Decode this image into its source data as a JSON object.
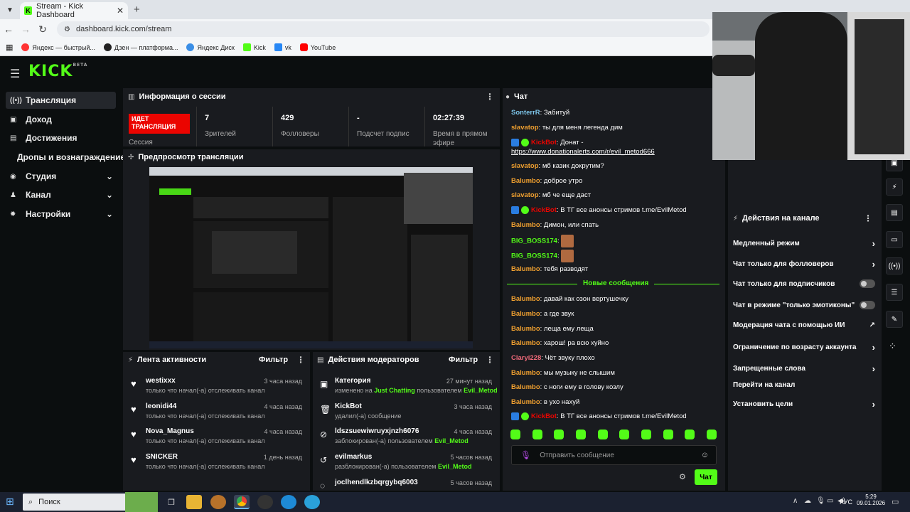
{
  "browser": {
    "tab_title": "Stream - Kick Dashboard",
    "url": "dashboard.kick.com/stream",
    "bookmarks": [
      "Яндекс — быстрый...",
      "Дзен — платформа...",
      "Яндекс Диск",
      "Kick",
      "vk",
      "YouTube"
    ]
  },
  "logo": {
    "text": "KICK",
    "badge": "BETA"
  },
  "sidebar": {
    "items": [
      {
        "label": "Трансляция"
      },
      {
        "label": "Доход"
      },
      {
        "label": "Достижения"
      },
      {
        "label": "Дропы и вознаграждение"
      },
      {
        "label": "Студия"
      },
      {
        "label": "Канал"
      },
      {
        "label": "Настройки"
      }
    ]
  },
  "session": {
    "title": "Информация о сессии",
    "badge_line1": "ИДЕТ",
    "badge_line2": "ТРАНСЛЯЦИЯ",
    "badge_sub": "Сессия",
    "stats": [
      {
        "value": "7",
        "label": "Зрителей"
      },
      {
        "value": "429",
        "label": "Фолловеры"
      },
      {
        "value": "-",
        "label": "Подсчет подпис"
      },
      {
        "value": "02:27:39",
        "label": "Время в прямом эфире"
      }
    ]
  },
  "preview": {
    "title": "Предпросмотр трансляции"
  },
  "activity": {
    "title": "Лента активности",
    "filter": "Фильтр",
    "items": [
      {
        "name": "westixxx",
        "text": "только что начал(-а) отслеживать канал",
        "time": "3 часа назад"
      },
      {
        "name": "leonidi44",
        "text": "только что начал(-а) отслеживать канал",
        "time": "4 часа назад"
      },
      {
        "name": "Nova_Magnus",
        "text": "только что начал(-а) отслеживать канал",
        "time": "4 часа назад"
      },
      {
        "name": "SNICKER",
        "text": "только что начал(-а) отслеживать канал",
        "time": "1 день назад"
      }
    ]
  },
  "moderators": {
    "title": "Действия модераторов",
    "filter": "Фильтр",
    "items": [
      {
        "name": "Категория",
        "pre": "изменено на",
        "hl1": "Just Chatting",
        "mid": "пользователем",
        "hl2": "Evil_Metod",
        "time": "27 минут назад"
      },
      {
        "name": "KickBot",
        "pre": "удалил(-а) сообщение",
        "hl1": "",
        "mid": "",
        "hl2": "",
        "time": "3 часа назад"
      },
      {
        "name": "ldszsuewiwruyxjnzh6076",
        "pre": "заблокирован(-а) пользователем",
        "hl1": "Evil_Metod",
        "mid": "",
        "hl2": "",
        "time": "4 часа назад"
      },
      {
        "name": "evilmarkus",
        "pre": "разблокирован(-а) пользователем",
        "hl1": "Evil_Metod",
        "mid": "",
        "hl2": "",
        "time": "5 часов назад"
      },
      {
        "name": "joclhendlkzbqrgybq6003",
        "pre": "",
        "hl1": "",
        "mid": "",
        "hl2": "",
        "time": "5 часов назад"
      }
    ]
  },
  "chat": {
    "title": "Чат",
    "new_messages": "Новые сообщения",
    "input_placeholder": "Отправить сообщение",
    "send_label": "Чат",
    "messages": [
      {
        "user": "SonterrR",
        "color": "#7cc4e8",
        "text": "Забитуй"
      },
      {
        "user": "slavatop",
        "color": "#f0a030",
        "text": "ты для меня легенда дим"
      },
      {
        "user": "KickBot",
        "color": "#eb0400",
        "text": "Донат -",
        "link": "https://www.donationalerts.com/r/evil_metod666",
        "bot": true
      },
      {
        "user": "slavatop",
        "color": "#f0a030",
        "text": "мб казик докрутим?"
      },
      {
        "user": "Balumbo",
        "color": "#f0a030",
        "text": "доброе утро"
      },
      {
        "user": "slavatop",
        "color": "#f0a030",
        "text": "мб че еще даст"
      },
      {
        "user": "KickBot",
        "color": "#eb0400",
        "text": "В ТГ все анонсы стримов t.me/EvilMetod",
        "bot": true
      },
      {
        "user": "Balumbo",
        "color": "#f0a030",
        "text": "Димон, или спать"
      },
      {
        "user": "BIG_BOSS174",
        "color": "#53fc18",
        "text": "",
        "emote": true
      },
      {
        "user": "BIG_BOSS174",
        "color": "#53fc18",
        "text": "",
        "emote": true
      },
      {
        "user": "Balumbo",
        "color": "#f0a030",
        "text": "тебя разводят"
      },
      {
        "user": "Balumbo",
        "color": "#f0a030",
        "text": "давай как озон вертушечку"
      },
      {
        "user": "Balumbo",
        "color": "#f0a030",
        "text": "а где звук"
      },
      {
        "user": "Balumbo",
        "color": "#f0a030",
        "text": "леща ему леща"
      },
      {
        "user": "Balumbo",
        "color": "#f0a030",
        "text": "харош! ра всю хуйно"
      },
      {
        "user": "Claryi228",
        "color": "#f06a7a",
        "text": "Чёт звуку плохо"
      },
      {
        "user": "Balumbo",
        "color": "#f0a030",
        "text": "мы музыку не слышим"
      },
      {
        "user": "Balumbo",
        "color": "#f0a030",
        "text": "с ноги ему в голову козлу"
      },
      {
        "user": "Balumbo",
        "color": "#f0a030",
        "text": "в ухо нахуй"
      },
      {
        "user": "KickBot",
        "color": "#eb0400",
        "text": "В ТГ все анонсы стримов t.me/EvilMetod",
        "bot": true
      }
    ]
  },
  "channel_actions": {
    "title": "Действия на канале",
    "items": [
      {
        "label": "Медленный режим",
        "control": "chevron"
      },
      {
        "label": "Чат только для фолловеров",
        "control": "chevron"
      },
      {
        "label": "Чат только для подписчиков",
        "control": "toggle"
      },
      {
        "label": "Чат в режиме \"только эмотиконы\"",
        "control": "toggle"
      },
      {
        "label": "Модерация чата с помощью ИИ",
        "control": "external"
      },
      {
        "label": "Ограничение по возрасту аккаунта",
        "control": "chevron"
      },
      {
        "label": "Запрещенные слова",
        "control": "chevron"
      },
      {
        "label": "Перейти на канал",
        "control": "none"
      },
      {
        "label": "Установить цели",
        "control": "chevron"
      }
    ]
  },
  "taskbar": {
    "search": "Поиск",
    "lang": "РУС",
    "time": "5:29",
    "date": "09.01.2026"
  }
}
